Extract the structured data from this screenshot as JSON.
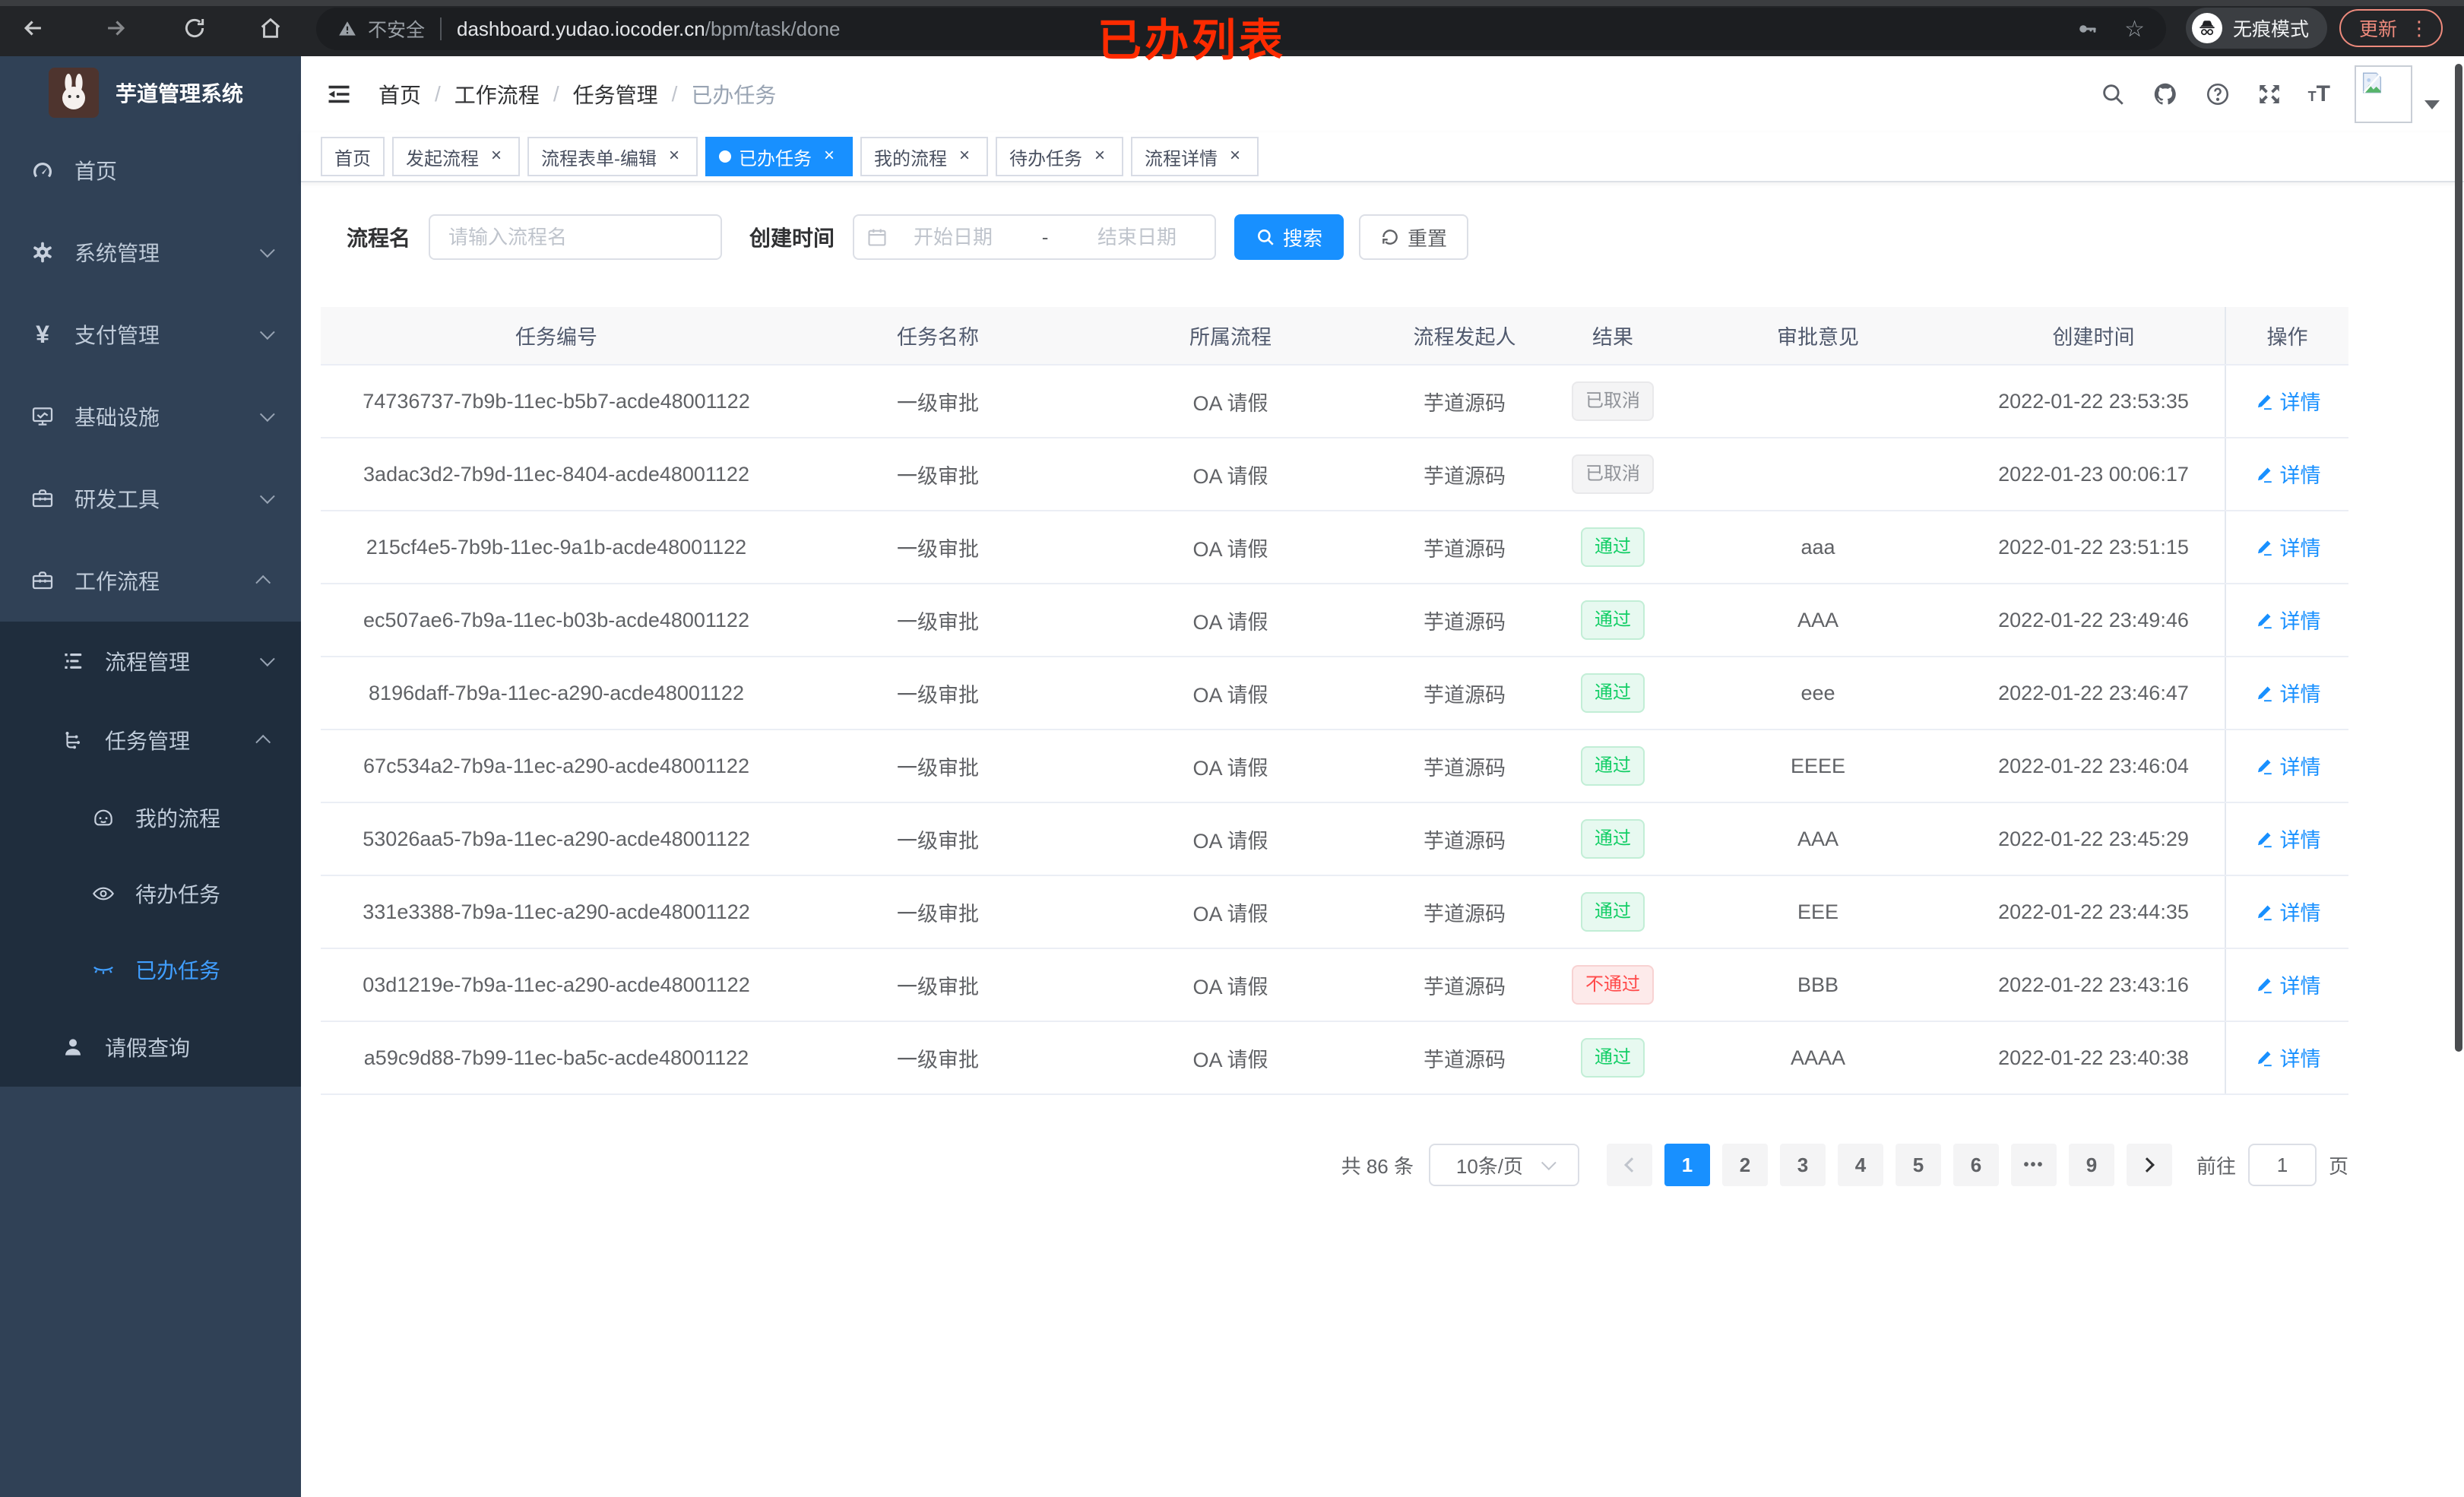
{
  "ui": {
    "close_glyph": "×"
  },
  "browser": {
    "security_text": "不安全",
    "url_host": "dashboard.yudao.iocoder.cn",
    "url_path": "/bpm/task/done",
    "annotation": "已办列表",
    "incognito_label": "无痕模式",
    "update_label": "更新",
    "menu_dots": "⋮",
    "star_glyph": "☆"
  },
  "sidebar": {
    "title": "芋道管理系统",
    "items": [
      {
        "label": "首页"
      },
      {
        "label": "系统管理"
      },
      {
        "label": "支付管理"
      },
      {
        "label": "基础设施"
      },
      {
        "label": "研发工具"
      },
      {
        "label": "工作流程"
      },
      {
        "label": "流程管理"
      },
      {
        "label": "任务管理"
      },
      {
        "label": "我的流程"
      },
      {
        "label": "待办任务"
      },
      {
        "label": "已办任务",
        "active": true
      },
      {
        "label": "请假查询"
      }
    ],
    "yen_glyph": "¥"
  },
  "navbar": {
    "breadcrumb": [
      "首页",
      "工作流程",
      "任务管理",
      "已办任务"
    ],
    "separator": "/"
  },
  "tabs": [
    {
      "label": "首页"
    },
    {
      "label": "发起流程"
    },
    {
      "label": "流程表单-编辑"
    },
    {
      "label": "已办任务",
      "active": true
    },
    {
      "label": "我的流程"
    },
    {
      "label": "待办任务"
    },
    {
      "label": "流程详情"
    }
  ],
  "filters": {
    "name_label": "流程名",
    "name_placeholder": "请输入流程名",
    "time_label": "创建时间",
    "start_placeholder": "开始日期",
    "separator": "-",
    "end_placeholder": "结束日期",
    "search_label": "搜索",
    "reset_label": "重置"
  },
  "table": {
    "headers": [
      "任务编号",
      "任务名称",
      "所属流程",
      "流程发起人",
      "结果",
      "审批意见",
      "创建时间",
      "操作"
    ],
    "action_label": "详情",
    "rows": [
      {
        "id": "74736737-7b9b-11ec-b5b7-acde48001122",
        "name": "一级审批",
        "process": "OA 请假",
        "starter": "芋道源码",
        "result": "已取消",
        "result_type": "info",
        "comment": "",
        "time": "2022-01-22 23:53:35"
      },
      {
        "id": "3adac3d2-7b9d-11ec-8404-acde48001122",
        "name": "一级审批",
        "process": "OA 请假",
        "starter": "芋道源码",
        "result": "已取消",
        "result_type": "info",
        "comment": "",
        "time": "2022-01-23 00:06:17"
      },
      {
        "id": "215cf4e5-7b9b-11ec-9a1b-acde48001122",
        "name": "一级审批",
        "process": "OA 请假",
        "starter": "芋道源码",
        "result": "通过",
        "result_type": "success",
        "comment": "aaa",
        "time": "2022-01-22 23:51:15"
      },
      {
        "id": "ec507ae6-7b9a-11ec-b03b-acde48001122",
        "name": "一级审批",
        "process": "OA 请假",
        "starter": "芋道源码",
        "result": "通过",
        "result_type": "success",
        "comment": "AAA",
        "time": "2022-01-22 23:49:46"
      },
      {
        "id": "8196daff-7b9a-11ec-a290-acde48001122",
        "name": "一级审批",
        "process": "OA 请假",
        "starter": "芋道源码",
        "result": "通过",
        "result_type": "success",
        "comment": "eee",
        "time": "2022-01-22 23:46:47"
      },
      {
        "id": "67c534a2-7b9a-11ec-a290-acde48001122",
        "name": "一级审批",
        "process": "OA 请假",
        "starter": "芋道源码",
        "result": "通过",
        "result_type": "success",
        "comment": "EEEE",
        "time": "2022-01-22 23:46:04"
      },
      {
        "id": "53026aa5-7b9a-11ec-a290-acde48001122",
        "name": "一级审批",
        "process": "OA 请假",
        "starter": "芋道源码",
        "result": "通过",
        "result_type": "success",
        "comment": "AAA",
        "time": "2022-01-22 23:45:29"
      },
      {
        "id": "331e3388-7b9a-11ec-a290-acde48001122",
        "name": "一级审批",
        "process": "OA 请假",
        "starter": "芋道源码",
        "result": "通过",
        "result_type": "success",
        "comment": "EEE",
        "time": "2022-01-22 23:44:35"
      },
      {
        "id": "03d1219e-7b9a-11ec-a290-acde48001122",
        "name": "一级审批",
        "process": "OA 请假",
        "starter": "芋道源码",
        "result": "不通过",
        "result_type": "danger",
        "comment": "BBB",
        "time": "2022-01-22 23:43:16"
      },
      {
        "id": "a59c9d88-7b99-11ec-ba5c-acde48001122",
        "name": "一级审批",
        "process": "OA 请假",
        "starter": "芋道源码",
        "result": "通过",
        "result_type": "success",
        "comment": "AAAA",
        "time": "2022-01-22 23:40:38"
      }
    ]
  },
  "pagination": {
    "total": "共 86 条",
    "page_size": "10条/页",
    "pages": [
      "1",
      "2",
      "3",
      "4",
      "5",
      "6",
      "•••",
      "9"
    ],
    "goto_label": "前往",
    "goto_value": "1",
    "page_label": "页"
  },
  "colors": {
    "accent": "#1890ff",
    "sidebar_bg": "#304156",
    "submenu_bg": "#1f2d3d",
    "active_text": "#409eff",
    "success": "#13ce66",
    "danger": "#ff4949",
    "info": "#909399"
  }
}
